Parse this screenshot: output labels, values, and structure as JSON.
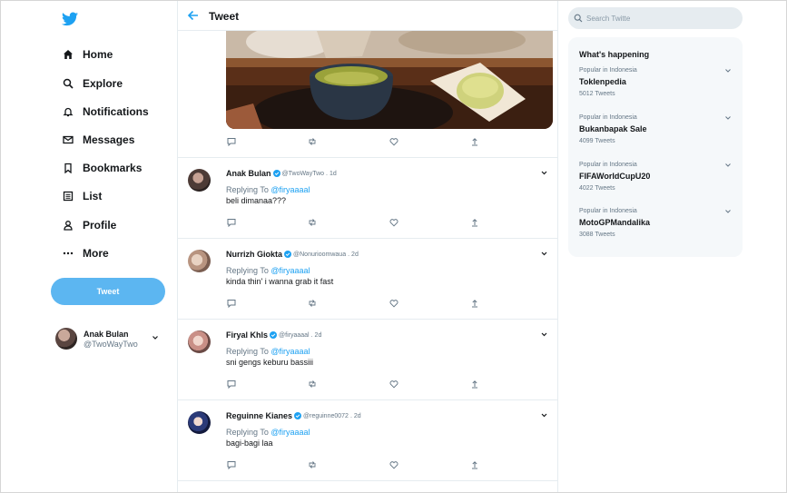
{
  "header": {
    "title": "Tweet"
  },
  "sidebar": {
    "items": [
      {
        "label": "Home",
        "icon": "home-icon"
      },
      {
        "label": "Explore",
        "icon": "search-icon"
      },
      {
        "label": "Notifications",
        "icon": "bell-icon"
      },
      {
        "label": "Messages",
        "icon": "envelope-icon"
      },
      {
        "label": "Bookmarks",
        "icon": "bookmark-icon"
      },
      {
        "label": "List",
        "icon": "list-icon"
      },
      {
        "label": "Profile",
        "icon": "person-icon"
      },
      {
        "label": "More",
        "icon": "more-dots-icon"
      }
    ],
    "tweet_label": "Tweet"
  },
  "account": {
    "name": "Anak Bulan",
    "handle": "@TwoWayTwo"
  },
  "replies": [
    {
      "name": "Anak Bulan",
      "handle": "@TwoWayTwo",
      "time": "1d",
      "replying_prefix": "Replying To",
      "mention": "@firyaaaal",
      "text": "beli dimanaa???"
    },
    {
      "name": "Nurrizh Giokta",
      "handle": "@Nonurioomwaua",
      "time": "2d",
      "replying_prefix": "Replying To",
      "mention": "@firyaaaal",
      "text": "kinda thin' i wanna grab it fast"
    },
    {
      "name": "Firyal Khls",
      "handle": "@firyaaaal",
      "time": "2d",
      "replying_prefix": "Replying To",
      "mention": "@firyaaaal",
      "text": "sni gengs keburu bassiii"
    },
    {
      "name": "Reguinne Kianes",
      "handle": "@reguinne0072",
      "time": "2d",
      "replying_prefix": "Replying To",
      "mention": "@firyaaaal",
      "text": "bagi-bagi laa"
    }
  ],
  "search": {
    "placeholder": "Search Twitte"
  },
  "trends": {
    "title": "What's happening",
    "items": [
      {
        "context": "Popular in Indonesia",
        "name": "Toklenpedia",
        "count": "5012 Tweets"
      },
      {
        "context": "Popular in Indonesia",
        "name": "Bukanbapak Sale",
        "count": "4099 Tweets"
      },
      {
        "context": "Popular in Indonesia",
        "name": "FIFAWorldCupU20",
        "count": "4022 Tweets"
      },
      {
        "context": "Popular in Indonesia",
        "name": "MotoGPMandalika",
        "count": "3088 Tweets"
      }
    ]
  },
  "colors": {
    "accent": "#1da1f2",
    "tweet_button": "#5cb6f1",
    "muted": "#657786",
    "trends_bg": "#f5f8fa"
  }
}
